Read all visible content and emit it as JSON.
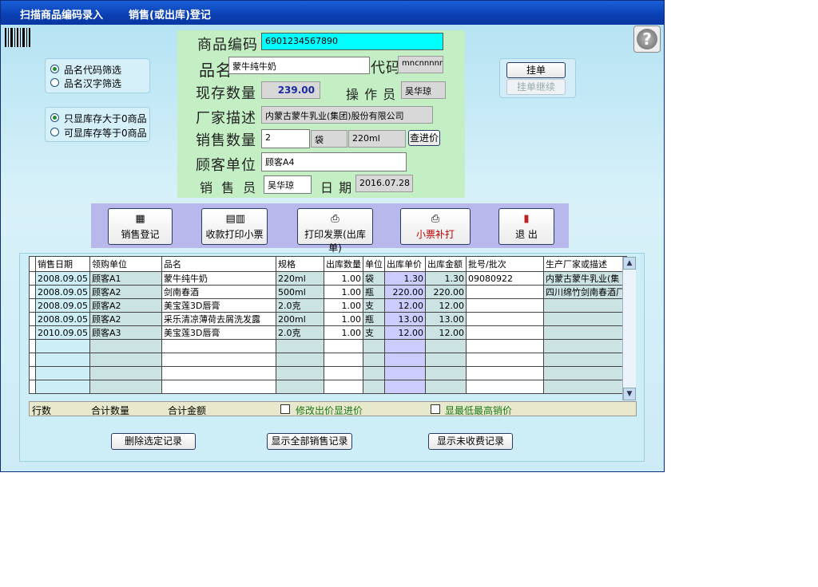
{
  "titlebar": {
    "title_left": "扫描商品编码录入",
    "title_right": "销售(或出库)登记"
  },
  "icons": {
    "barcode": "barcode-icon",
    "help": "help-icon"
  },
  "help": {
    "glyph": "?"
  },
  "filters": {
    "group1": [
      {
        "label": "品名代码筛选",
        "checked": true
      },
      {
        "label": "品名汉字筛选",
        "checked": false
      }
    ],
    "group2": [
      {
        "label": "只显库存大于0商品",
        "checked": true
      },
      {
        "label": "可显库存等于0商品",
        "checked": false
      }
    ]
  },
  "form": {
    "code_label": "商品编码",
    "code_value": "6901234567890",
    "name_label": "品名",
    "name_value": "蒙牛纯牛奶",
    "daima_label": "代码",
    "daima_value": "mncnnnnn",
    "stock_label": "现存数量",
    "stock_value": "239.00",
    "operator_label": "操 作 员",
    "operator_value": "吴华琼",
    "maker_label": "厂家描述",
    "maker_value": "内蒙古蒙牛乳业(集团)股份有限公司",
    "qty_label": "销售数量",
    "qty_value": "2",
    "unit_value": "袋",
    "spec_value": "220ml",
    "check_price_label": "查进价",
    "customer_label": "顾客单位",
    "customer_value": "顾客A4",
    "seller_label": "销 售 员",
    "seller_value": "吴华琼",
    "date_label": "日 期",
    "date_value": "2016.07.28"
  },
  "hang": {
    "hang_label": "挂单",
    "resume_label": "挂单继续"
  },
  "toolbar": {
    "register": "销售登记",
    "print_receipt": "收款打印小票",
    "print_invoice": "打印发票(出库单)",
    "reprint": "小票补打",
    "exit": "退 出"
  },
  "colors": {
    "reprint_text": "#c00000",
    "highlight_col": "#ccccff",
    "form_bg": "#c4efc4",
    "toolbar_bg": "#b8b8ec"
  },
  "grid": {
    "headers": [
      "销售日期",
      "领购单位",
      "品名",
      "规格",
      "出库数量",
      "单位",
      "出库单价",
      "出库金额",
      "批号/批次",
      "生产厂家或描述"
    ],
    "rows": [
      [
        "2008.09.05",
        "顾客A1",
        "蒙牛纯牛奶",
        "220ml",
        "1.00",
        "袋",
        "1.30",
        "1.30",
        "09080922",
        "内蒙古蒙牛乳业(集"
      ],
      [
        "2008.09.05",
        "顾客A2",
        "剑南春酒",
        "500ml",
        "1.00",
        "瓶",
        "220.00",
        "220.00",
        "",
        "四川绵竹剑南春酒厂"
      ],
      [
        "2008.09.05",
        "顾客A2",
        "美宝莲3D唇膏",
        "2.0克",
        "1.00",
        "支",
        "12.00",
        "12.00",
        "",
        ""
      ],
      [
        "2008.09.05",
        "顾客A2",
        "采乐清凉薄荷去屑洗发露",
        "200ml",
        "1.00",
        "瓶",
        "13.00",
        "13.00",
        "",
        ""
      ],
      [
        "2010.09.05",
        "顾客A3",
        "美宝莲3D唇膏",
        "2.0克",
        "1.00",
        "支",
        "12.00",
        "12.00",
        "",
        ""
      ],
      [
        "",
        "",
        "",
        "",
        "",
        "",
        "",
        "",
        "",
        ""
      ],
      [
        "",
        "",
        "",
        "",
        "",
        "",
        "",
        "",
        "",
        ""
      ],
      [
        "",
        "",
        "",
        "",
        "",
        "",
        "",
        "",
        "",
        ""
      ],
      [
        "",
        "",
        "",
        "",
        "",
        "",
        "",
        "",
        "",
        ""
      ]
    ]
  },
  "footer": {
    "rows_label": "行数",
    "total_qty_label": "合计数量",
    "total_amt_label": "合计金额",
    "edit_price_label": "修改出价显进价",
    "show_minmax_label": "显最低最高销价"
  },
  "actions": {
    "delete_selected": "删除选定记录",
    "show_all": "显示全部销售记录",
    "show_unpaid": "显示未收费记录"
  }
}
